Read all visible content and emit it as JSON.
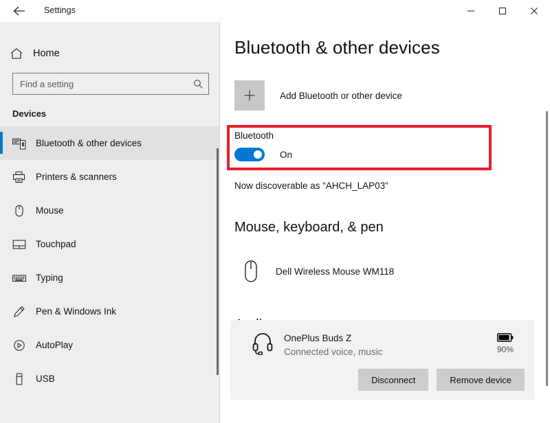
{
  "window": {
    "title": "Settings",
    "back_icon": "back-arrow-icon",
    "minimize_label": "Minimize",
    "maximize_label": "Maximize",
    "close_label": "Close"
  },
  "sidebar": {
    "home": {
      "label": "Home",
      "icon": "home-icon"
    },
    "search": {
      "placeholder": "Find a setting",
      "value": "",
      "icon": "search-icon"
    },
    "section_title": "Devices",
    "items": [
      {
        "label": "Bluetooth & other devices",
        "icon": "bluetooth-devices-icon",
        "selected": true
      },
      {
        "label": "Printers & scanners",
        "icon": "printer-icon",
        "selected": false
      },
      {
        "label": "Mouse",
        "icon": "mouse-icon",
        "selected": false
      },
      {
        "label": "Touchpad",
        "icon": "touchpad-icon",
        "selected": false
      },
      {
        "label": "Typing",
        "icon": "keyboard-icon",
        "selected": false
      },
      {
        "label": "Pen & Windows Ink",
        "icon": "pen-icon",
        "selected": false
      },
      {
        "label": "AutoPlay",
        "icon": "autoplay-icon",
        "selected": false
      },
      {
        "label": "USB",
        "icon": "usb-icon",
        "selected": false
      }
    ]
  },
  "main": {
    "page_title": "Bluetooth & other devices",
    "add_device": {
      "label": "Add Bluetooth or other device",
      "icon": "plus-icon"
    },
    "bluetooth": {
      "label": "Bluetooth",
      "state_label": "On",
      "toggle_on": true,
      "discoverable_text": "Now discoverable as “AHCH_LAP03”",
      "highlight_color": "#ea1d2c",
      "accent_color": "#0078d4"
    },
    "mouse_group": {
      "heading": "Mouse, keyboard, & pen",
      "devices": [
        {
          "name": "Dell Wireless Mouse WM118",
          "icon": "mouse-icon"
        }
      ]
    },
    "audio_group": {
      "heading": "Audio",
      "device": {
        "name": "OnePlus Buds Z",
        "status": "Connected voice, music",
        "icon": "headset-icon",
        "battery_icon": "battery-icon",
        "battery_percent": "90%"
      },
      "buttons": [
        {
          "label": "Disconnect"
        },
        {
          "label": "Remove device"
        }
      ]
    }
  }
}
